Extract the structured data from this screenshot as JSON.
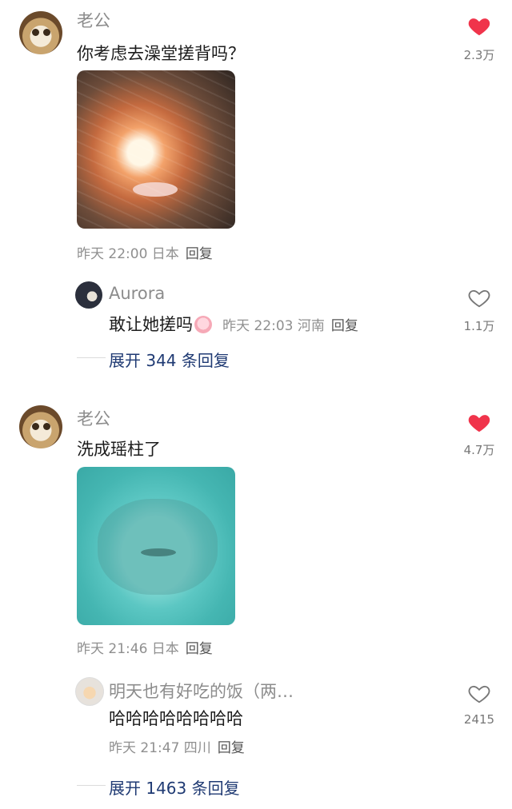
{
  "comments": [
    {
      "username": "老公",
      "text": "你考虑去澡堂搓背吗？",
      "meta": "昨天 22:00 日本",
      "reply_label": "回复",
      "likes": "2.3万",
      "liked": true,
      "replies": [
        {
          "username": "Aurora",
          "text": "敢让她搓吗",
          "meta": "昨天 22:03 河南",
          "reply_label": "回复",
          "likes": "1.1万",
          "liked": false
        }
      ],
      "expand_label": "展开 344 条回复"
    },
    {
      "username": "老公",
      "text": "洗成瑶柱了",
      "meta": "昨天 21:46 日本",
      "reply_label": "回复",
      "likes": "4.7万",
      "liked": true,
      "replies": [
        {
          "username": "明天也有好吃的饭（两…",
          "text": "哈哈哈哈哈哈哈哈",
          "meta": "昨天 21:47 四川",
          "reply_label": "回复",
          "likes": "2415",
          "liked": false
        }
      ],
      "expand_label": "展开 1463 条回复"
    }
  ],
  "colors": {
    "heart_liked": "#f0344b",
    "heart_outline": "#777777",
    "expand_link": "#1f3a73"
  },
  "icons": {
    "heart_filled": "heart-filled-icon",
    "heart_outline": "heart-outline-icon"
  }
}
